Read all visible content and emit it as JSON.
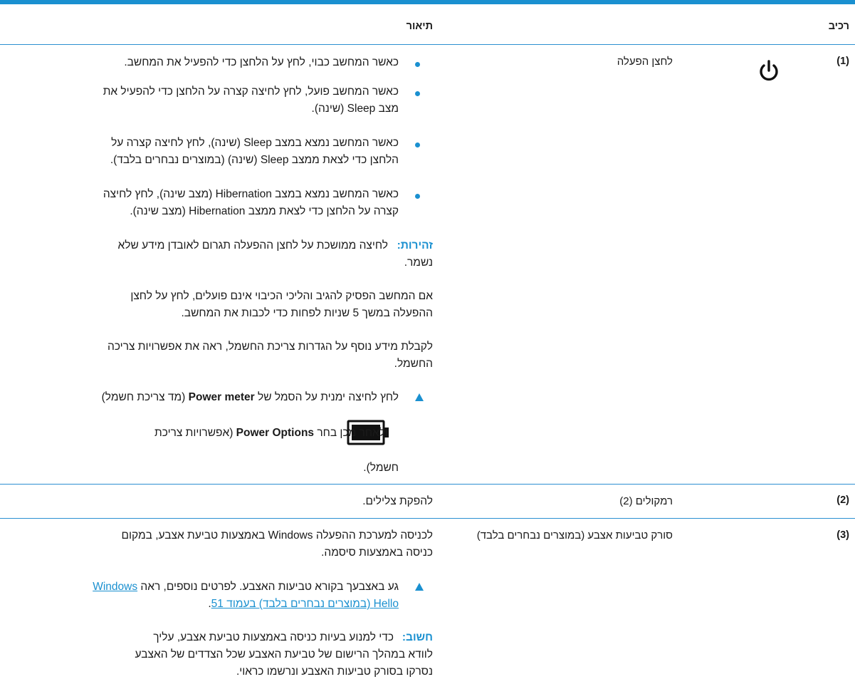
{
  "header": {
    "component": "רכיב",
    "description": "תיאור"
  },
  "rows": [
    {
      "number": "(1)",
      "name": "לחצן הפעלה",
      "icon": "power-icon",
      "bullets": [
        [
          "כאשר המחשב כבוי, לחץ על הלחצן כדי להפעיל את המחשב."
        ],
        [
          "כאשר המחשב פועל, לחץ לחיצה קצרה על הלחצן כדי להפעיל את",
          "מצב Sleep (שינה)."
        ],
        [
          "כאשר המחשב נמצא במצב Sleep (שינה), לחץ לחיצה קצרה על",
          "הלחצן כדי לצאת ממצב Sleep (שינה) (במוצרים נבחרים בלבד)."
        ],
        [
          "כאשר המחשב נמצא במצב Hibernation (מצב שינה), לחץ לחיצה",
          "קצרה על הלחצן כדי לצאת ממצב Hibernation (מצב שינה)."
        ]
      ],
      "warning_label": "זהירות:",
      "warning_line1": "לחיצה ממושכת על לחצן ההפעלה תגרום לאובדן מידע שלא",
      "warning_line2": "נשמר.",
      "para1": [
        "אם המחשב הפסיק להגיב והליכי הכיבוי אינם פועלים, לחץ על לחצן",
        "ההפעלה במשך 5 שניות לפחות כדי לכבות את המחשב."
      ],
      "para2": [
        "לקבלת מידע נוסף על הגדרות צריכת החשמל, ראה את אפשרויות צריכה",
        "החשמל."
      ],
      "step_a": "לחץ לחיצה ימנית על הסמל של",
      "step_b": "Power meter",
      "step_c": "(מד צריכת חשמל)",
      "step2_a": "ולאחר מכן בחר",
      "step2_b": "Power Options",
      "step2_c": "(אפשרויות צריכת",
      "step3": "חשמל).",
      "battery_icon": "battery-icon"
    },
    {
      "number": "(2)",
      "name": "רמקולים (2)",
      "description": "להפקת צלילים."
    },
    {
      "number": "(3)",
      "name": "סורק טביעות אצבע (במוצרים נבחרים בלבד)",
      "intro": [
        "לכניסה למערכת ההפעלה Windows באמצעות טביעת אצבע, במקום",
        "כניסה באמצעות סיסמה."
      ],
      "step_a": "גע באצבעך בקורא טביעות האצבע. לפרטים נוספים, ראה",
      "link_a": "Windows",
      "link_b": "Hello (במוצרים נבחרים בלבד) בעמוד 51",
      "step_end": ".",
      "note_label": "חשוב:",
      "note_lines": [
        "כדי למנוע בעיות כניסה באמצעות טביעת אצבע, עליך",
        "לוודא במהלך הרישום של טביעת האצבע שכל הצדדים של האצבע",
        "נסרקו בסורק טביעות האצבע ונרשמו כראוי."
      ]
    }
  ]
}
